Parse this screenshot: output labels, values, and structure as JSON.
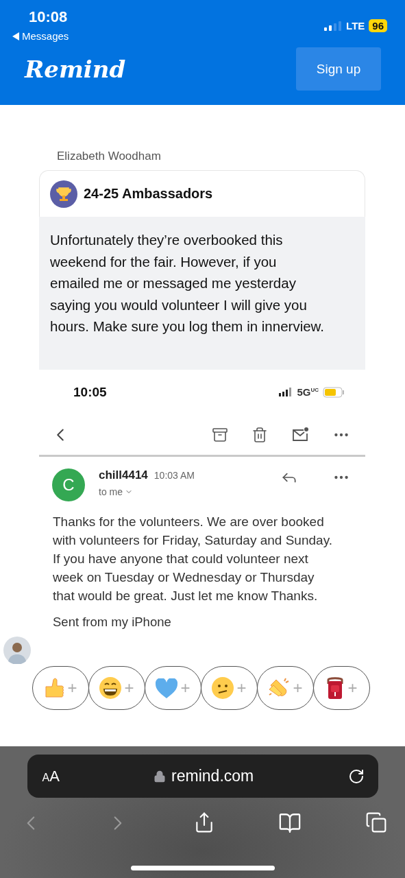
{
  "status_bar": {
    "time": "10:08",
    "back_label": "Messages",
    "network": "LTE",
    "battery": "96"
  },
  "header": {
    "logo": "Remind",
    "button": "Sign up"
  },
  "message": {
    "sender": "Elizabeth Woodham",
    "group": "24-25 Ambassadors",
    "text": "Unfortunately they’re overbooked this weekend for the fair. However, if you emailed me or messaged me yesterday saying you would volunteer I will give you hours. Make sure you log them in innerview."
  },
  "attachment": {
    "time": "10:05",
    "network": "5G",
    "network_mark": "UC",
    "email": {
      "avatar_letter": "C",
      "sender": "chill4414",
      "time": "10:03 AM",
      "recipient": "to me",
      "body": "Thanks for the volunteers. We are over booked with volunteers for Friday, Saturday and Sunday. If you have anyone that could volunteer next week on Tuesday or Wednesday or Thursday that would be great. Just let me know  Thanks.",
      "signature": "Sent from my iPhone"
    }
  },
  "reactions": [
    {
      "kind": "thumbs-up",
      "add": "+"
    },
    {
      "kind": "grin",
      "add": "+"
    },
    {
      "kind": "heart",
      "add": "+"
    },
    {
      "kind": "confused",
      "add": "+"
    },
    {
      "kind": "clap",
      "add": "+"
    },
    {
      "kind": "backpack",
      "add": "+"
    }
  ],
  "browser": {
    "text_size": "AA",
    "url": "remind.com"
  }
}
